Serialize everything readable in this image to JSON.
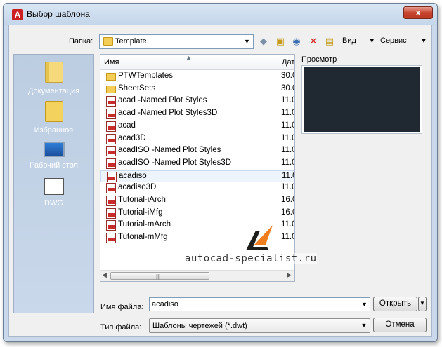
{
  "window": {
    "title": "Выбор шаблона",
    "close_symbol": "x"
  },
  "toolbar": {
    "folder_label": "Папка:",
    "folder_value": "Template",
    "back_icon": "◆",
    "up_icon": "▣",
    "search_icon": "◉",
    "delete_icon": "✕",
    "newfolder_icon": "▤",
    "view_label": "Вид",
    "service_label": "Сервис"
  },
  "places": [
    {
      "label": "Документация",
      "icon": "documents-icon"
    },
    {
      "label": "Избранное",
      "icon": "favorites-icon"
    },
    {
      "label": "Рабочий стол",
      "icon": "desktop-icon"
    },
    {
      "label": "DWG",
      "icon": "dwg-folder-icon"
    }
  ],
  "filelist": {
    "col_name": "Имя",
    "col_date": "Дат",
    "rows": [
      {
        "name": "PTWTemplates",
        "date": "30.0",
        "type": "folder"
      },
      {
        "name": "SheetSets",
        "date": "30.0",
        "type": "folder"
      },
      {
        "name": "acad -Named Plot Styles",
        "date": "11.0",
        "type": "dwt"
      },
      {
        "name": "acad -Named Plot Styles3D",
        "date": "11.0",
        "type": "dwt"
      },
      {
        "name": "acad",
        "date": "11.0",
        "type": "dwt"
      },
      {
        "name": "acad3D",
        "date": "11.0",
        "type": "dwt"
      },
      {
        "name": "acadISO -Named Plot Styles",
        "date": "11.0",
        "type": "dwt"
      },
      {
        "name": "acadISO -Named Plot Styles3D",
        "date": "11.0",
        "type": "dwt"
      },
      {
        "name": "acadiso",
        "date": "11.0",
        "type": "dwt",
        "selected": true
      },
      {
        "name": "acadiso3D",
        "date": "11.0",
        "type": "dwt"
      },
      {
        "name": "Tutorial-iArch",
        "date": "16.0",
        "type": "dwt"
      },
      {
        "name": "Tutorial-iMfg",
        "date": "16.0",
        "type": "dwt"
      },
      {
        "name": "Tutorial-mArch",
        "date": "11.0",
        "type": "dwt"
      },
      {
        "name": "Tutorial-mMfg",
        "date": "11.0",
        "type": "dwt"
      }
    ]
  },
  "preview": {
    "label": "Просмотр"
  },
  "watermark": {
    "text": "autocad-specialist.ru"
  },
  "form": {
    "filename_label": "Имя файла:",
    "filename_value": "acadiso",
    "filetype_label": "Тип файла:",
    "filetype_value": "Шаблоны чертежей (*.dwt)",
    "open_label": "Открыть",
    "cancel_label": "Отмена"
  },
  "colors": {
    "accent": "#c9d8ea",
    "preview_bg": "#202932",
    "close": "#c8442f",
    "logo": "#f07e1f"
  }
}
